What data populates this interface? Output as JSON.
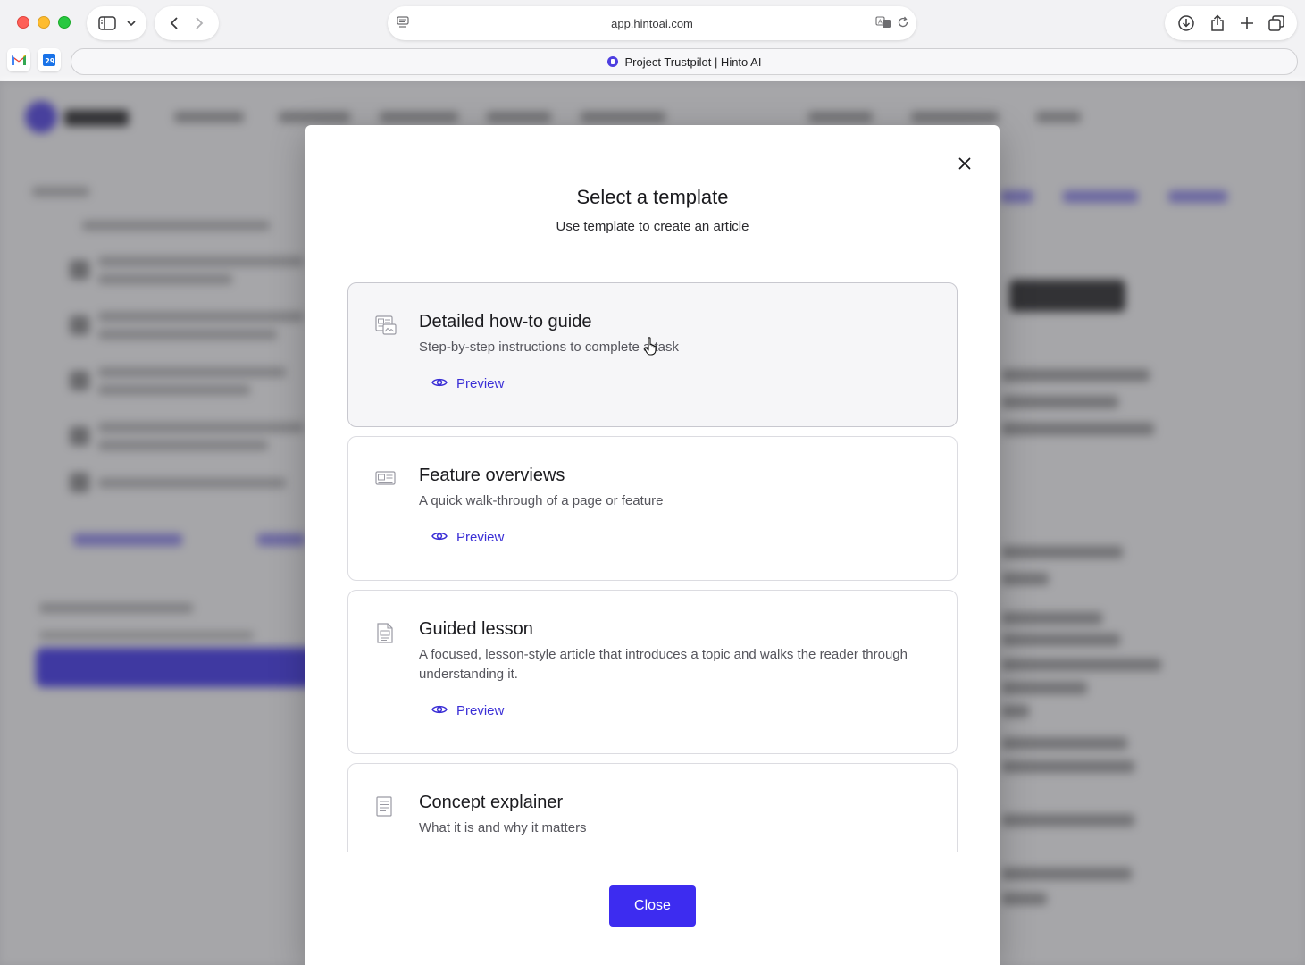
{
  "browser": {
    "url": "app.hintoai.com",
    "tab_title": "Project Trustpilot | Hinto AI",
    "favorites": [
      {
        "name": "gmail-icon"
      },
      {
        "name": "calendar-icon",
        "label": "29"
      }
    ]
  },
  "modal": {
    "title": "Select a template",
    "subtitle": "Use template to create an article",
    "preview_label": "Preview",
    "close_button": "Close",
    "templates": [
      {
        "title": "Detailed how-to guide",
        "description": "Step-by-step instructions to complete a task",
        "icon": "guide-doc-icon"
      },
      {
        "title": "Feature overviews",
        "description": "A quick walk-through of a page or feature",
        "icon": "overview-doc-icon"
      },
      {
        "title": "Guided lesson",
        "description": "A focused, lesson-style article that introduces a topic and walks the reader through understanding it.",
        "icon": "lesson-doc-icon"
      },
      {
        "title": "Concept explainer",
        "description": "What it is and why it matters",
        "icon": "explainer-doc-icon"
      }
    ]
  },
  "colors": {
    "accent": "#3d2cf0",
    "link": "#3b2fd6",
    "overlay": "#46464b"
  }
}
